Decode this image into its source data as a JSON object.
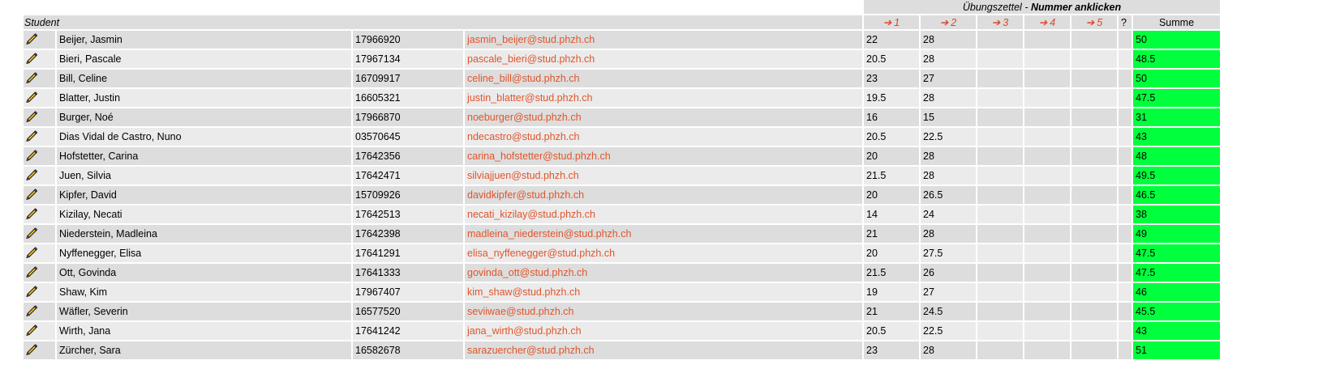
{
  "header": {
    "uebungszettel_label": "Übungszettel",
    "separator": " - ",
    "instruction": "Nummer anklicken",
    "student_label": "Student",
    "question_label": "?",
    "summe_label": "Summe",
    "sheets": [
      {
        "arrow": "➔",
        "num": "1"
      },
      {
        "arrow": "➔",
        "num": "2"
      },
      {
        "arrow": "➔",
        "num": "3"
      },
      {
        "arrow": "➔",
        "num": "4"
      },
      {
        "arrow": "➔",
        "num": "5"
      }
    ]
  },
  "colors": {
    "link": "#e0552b",
    "sum_bg": "#00ff3c",
    "row_dark": "#dddddd",
    "row_light": "#ebebeb"
  },
  "icons": {
    "edit": "pencil-icon"
  },
  "students": [
    {
      "name": "Beijer, Jasmin",
      "id": "17966920",
      "email": "jasmin_beijer@stud.phzh.ch",
      "s1": "22",
      "s2": "28",
      "sum": "50"
    },
    {
      "name": "Bieri, Pascale",
      "id": "17967134",
      "email": "pascale_bieri@stud.phzh.ch",
      "s1": "20.5",
      "s2": "28",
      "sum": "48.5"
    },
    {
      "name": "Bill, Celine",
      "id": "16709917",
      "email": "celine_bill@stud.phzh.ch",
      "s1": "23",
      "s2": "27",
      "sum": "50"
    },
    {
      "name": "Blatter, Justin",
      "id": "16605321",
      "email": "justin_blatter@stud.phzh.ch",
      "s1": "19.5",
      "s2": "28",
      "sum": "47.5"
    },
    {
      "name": "Burger, Noé",
      "id": "17966870",
      "email": "noeburger@stud.phzh.ch",
      "s1": "16",
      "s2": "15",
      "sum": "31"
    },
    {
      "name": "Dias Vidal de Castro, Nuno",
      "id": "03570645",
      "email": "ndecastro@stud.phzh.ch",
      "s1": "20.5",
      "s2": "22.5",
      "sum": "43"
    },
    {
      "name": "Hofstetter, Carina",
      "id": "17642356",
      "email": "carina_hofstetter@stud.phzh.ch",
      "s1": "20",
      "s2": "28",
      "sum": "48"
    },
    {
      "name": "Juen, Silvia",
      "id": "17642471",
      "email": "silviajjuen@stud.phzh.ch",
      "s1": "21.5",
      "s2": "28",
      "sum": "49.5"
    },
    {
      "name": "Kipfer, David",
      "id": "15709926",
      "email": "davidkipfer@stud.phzh.ch",
      "s1": "20",
      "s2": "26.5",
      "sum": "46.5"
    },
    {
      "name": "Kizilay, Necati",
      "id": "17642513",
      "email": "necati_kizilay@stud.phzh.ch",
      "s1": "14",
      "s2": "24",
      "sum": "38"
    },
    {
      "name": "Niederstein, Madleina",
      "id": "17642398",
      "email": "madleina_niederstein@stud.phzh.ch",
      "s1": "21",
      "s2": "28",
      "sum": "49"
    },
    {
      "name": "Nyffenegger, Elisa",
      "id": "17641291",
      "email": "elisa_nyffenegger@stud.phzh.ch",
      "s1": "20",
      "s2": "27.5",
      "sum": "47.5"
    },
    {
      "name": "Ott, Govinda",
      "id": "17641333",
      "email": "govinda_ott@stud.phzh.ch",
      "s1": "21.5",
      "s2": "26",
      "sum": "47.5"
    },
    {
      "name": "Shaw, Kim",
      "id": "17967407",
      "email": "kim_shaw@stud.phzh.ch",
      "s1": "19",
      "s2": "27",
      "sum": "46"
    },
    {
      "name": "Wäfler, Severin",
      "id": "16577520",
      "email": "seviiwae@stud.phzh.ch",
      "s1": "21",
      "s2": "24.5",
      "sum": "45.5"
    },
    {
      "name": "Wirth, Jana",
      "id": "17641242",
      "email": "jana_wirth@stud.phzh.ch",
      "s1": "20.5",
      "s2": "22.5",
      "sum": "43"
    },
    {
      "name": "Zürcher, Sara",
      "id": "16582678",
      "email": "sarazuercher@stud.phzh.ch",
      "s1": "23",
      "s2": "28",
      "sum": "51"
    }
  ]
}
